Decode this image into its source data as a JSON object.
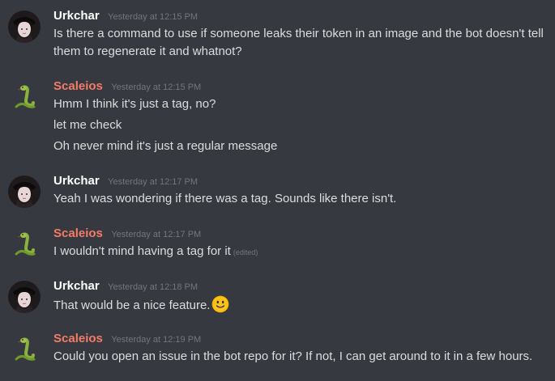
{
  "messages": [
    {
      "author": "Urkchar",
      "timestamp": "Yesterday at 12:15 PM",
      "lines": [
        "Is there a command to use if someone leaks their token in an image and the bot doesn't tell them to regenerate it and whatnot?"
      ]
    },
    {
      "author": "Scaleios",
      "timestamp": "Yesterday at 12:15 PM",
      "lines": [
        "Hmm I think it's just a tag, no?",
        "let me check",
        "Oh never mind it's just a regular message"
      ]
    },
    {
      "author": "Urkchar",
      "timestamp": "Yesterday at 12:17 PM",
      "lines": [
        "Yeah I was wondering if there was a tag. Sounds like there isn't."
      ]
    },
    {
      "author": "Scaleios",
      "timestamp": "Yesterday at 12:17 PM",
      "lines": [
        "I wouldn't mind having a tag for it"
      ],
      "edited": "(edited)"
    },
    {
      "author": "Urkchar",
      "timestamp": "Yesterday at 12:18 PM",
      "lines": [
        "That would be a nice feature."
      ],
      "emoji": "slightly-smiling-face-emoji"
    },
    {
      "author": "Scaleios",
      "timestamp": "Yesterday at 12:19 PM",
      "lines": [
        "Could you open an issue in the bot repo for it? If not, I can get around to it in a few hours."
      ]
    }
  ],
  "colors": {
    "background": "#36393f",
    "urkchar_name": "#ffffff",
    "scaleios_name": "#f47b67",
    "timestamp": "#72767d",
    "text": "#dcddde"
  }
}
